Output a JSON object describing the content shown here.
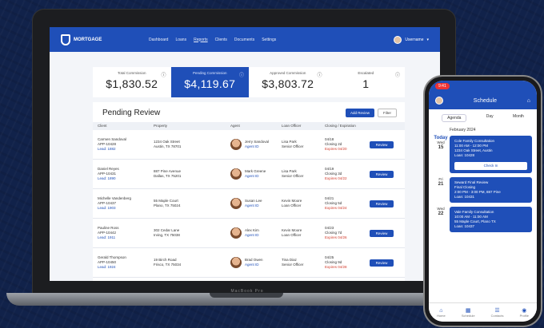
{
  "app": {
    "logo_text": "MORTGAGE",
    "nav": [
      "Dashboard",
      "Loans",
      "Reports",
      "Clients",
      "Documents",
      "Settings"
    ],
    "user_name": "Username"
  },
  "stats": [
    {
      "label": "Total Commission",
      "value": "$1,830.52"
    },
    {
      "label": "Pending Commission",
      "value": "$4,119.67"
    },
    {
      "label": "Approved Commission",
      "value": "$3,803.72"
    },
    {
      "label": "Escalated",
      "value": "1"
    }
  ],
  "panel": {
    "title": "Pending Review",
    "primary_button": "Add Review",
    "secondary_button": "Filter",
    "columns": [
      "Client",
      "Property",
      "Agent",
      "Loan Officer",
      "Closing / Expiration",
      ""
    ]
  },
  "rows": [
    {
      "client": [
        "Carmen Sandoval",
        "APP-10428",
        "Lead: 1882"
      ],
      "property": [
        "1234 Oak Street",
        "Austin, TX 78701"
      ],
      "agent": [
        "Jerry Sandoval",
        "Agent ID"
      ],
      "officer": [
        "Lisa Park",
        "Senior Officer"
      ],
      "closing": [
        "04/18",
        "Closing 2d",
        "Expires 04/20"
      ],
      "action": "Review"
    },
    {
      "client": [
        "Daniel Reyes",
        "APP-10431",
        "Lead: 1890"
      ],
      "property": [
        "887 Pine Avenue",
        "Dallas, TX 75201"
      ],
      "agent": [
        "Mark Greene",
        "Agent ID"
      ],
      "officer": [
        "Lisa Park",
        "Senior Officer"
      ],
      "closing": [
        "04/19",
        "Closing 3d",
        "Expires 04/22"
      ],
      "action": "Review"
    },
    {
      "client": [
        "Michelle Vandenberg",
        "APP-10437",
        "Lead: 1903"
      ],
      "property": [
        "55 Maple Court",
        "Plano, TX 75024"
      ],
      "agent": [
        "Susan Lee",
        "Agent ID"
      ],
      "officer": [
        "Kevin Moore",
        "Loan Officer"
      ],
      "closing": [
        "04/21",
        "Closing 5d",
        "Expires 04/24"
      ],
      "action": "Review"
    },
    {
      "client": [
        "Pauline Ross",
        "APP-10442",
        "Lead: 1911"
      ],
      "property": [
        "302 Cedar Lane",
        "Irving, TX 75038"
      ],
      "agent": [
        "Alex Kim",
        "Agent ID"
      ],
      "officer": [
        "Kevin Moore",
        "Loan Officer"
      ],
      "closing": [
        "04/23",
        "Closing 7d",
        "Expires 04/26"
      ],
      "action": "Review"
    },
    {
      "client": [
        "Gerald Thompson",
        "APP-10450",
        "Lead: 1924"
      ],
      "property": [
        "19 Birch Road",
        "Frisco, TX 75034"
      ],
      "agent": [
        "Brad Owen",
        "Agent ID"
      ],
      "officer": [
        "Tina Diaz",
        "Senior Officer"
      ],
      "closing": [
        "04/25",
        "Closing 9d",
        "Expires 04/28"
      ],
      "action": "Review"
    }
  ],
  "laptop_label": "MacBook Pro",
  "phone": {
    "time": "9:41",
    "title": "Schedule",
    "segments": [
      "Agenda",
      "Day",
      "Month"
    ],
    "month": "February 2024",
    "days": [
      {
        "marker": "Today",
        "dow": "Wed",
        "num": "15",
        "lines": [
          "Cole Family Consultation",
          "11:00 AM - 12:00 PM",
          "1234 Oak Street, Austin",
          "Loan: 10428"
        ],
        "button": "Check In"
      },
      {
        "marker": "",
        "dow": "Fri",
        "num": "21",
        "lines": [
          "Seward Final Review",
          "Final Closing",
          "2:00 PM - 3:00 PM, 887 Pine",
          "Loan: 10431"
        ],
        "button": ""
      },
      {
        "marker": "",
        "dow": "Wed",
        "num": "22",
        "lines": [
          "Vale Family Consultation",
          "10:00 AM - 11:00 AM",
          "55 Maple Court, Plano TX",
          "Loan: 10437"
        ],
        "button": ""
      }
    ],
    "tabs": [
      "Home",
      "Schedule",
      "Contacts",
      "Profile"
    ]
  }
}
